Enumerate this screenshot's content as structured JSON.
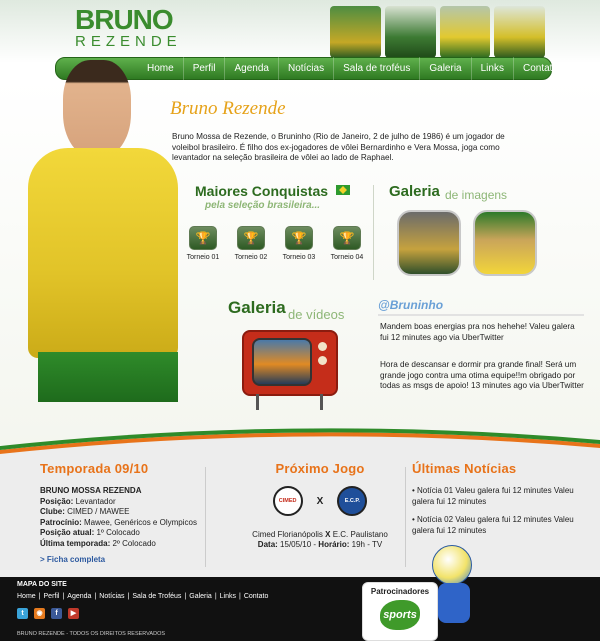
{
  "brand": {
    "line1": "BRUNO",
    "line2": "REZENDE"
  },
  "nav": [
    "Home",
    "Perfil",
    "Agenda",
    "Notícias",
    "Sala de troféus",
    "Galeria",
    "Links",
    "Contato"
  ],
  "bio": {
    "title": "Bruno Rezende",
    "text": "Bruno Mossa de Rezende, o Bruninho (Rio de Janeiro, 2 de julho de 1986) é um jogador de voleibol brasileiro. É filho dos ex-jogadores de vôlei Bernardinho e Vera Mossa, joga como levantador na seleção brasileira de vôlei ao lado de Raphael."
  },
  "conquistas": {
    "title": "Maiores Conquistas",
    "subtitle": "pela seleção brasileira...",
    "items": [
      "Torneio 01",
      "Torneio 02",
      "Torneio 03",
      "Torneio 04"
    ]
  },
  "galeria_imagens": {
    "title": "Galeria",
    "subtitle": "de imagens"
  },
  "galeria_videos": {
    "title": "Galeria",
    "subtitle": "de vídeos"
  },
  "twitter": {
    "handle": "@Bruninho",
    "tweets": [
      "Mandem boas energias pra nos hehehe! Valeu galera fui 12 minutes ago via UberTwitter",
      "Hora de descansar e dormir pra grande final! Será um grande jogo contra uma otima equipe!!m obrigado por todas as msgs de apoio! 13 minutes ago via UberTwitter"
    ]
  },
  "temporada": {
    "title": "Temporada 09/10",
    "name": "BRUNO MOSSA REZENDA",
    "rows": [
      {
        "label": "Posição:",
        "value": "Levantador"
      },
      {
        "label": "Clube:",
        "value": "CIMED / MAWEE"
      },
      {
        "label": "Patrocínio:",
        "value": "Mawee, Genéricos e Olympicos"
      },
      {
        "label": "Posição atual:",
        "value": "1º Colocado"
      },
      {
        "label": "Última temporada:",
        "value": "2º Colocado"
      }
    ],
    "link": "> Ficha completa"
  },
  "proximo_jogo": {
    "title": "Próximo Jogo",
    "team1_badge": "CIMED",
    "vs": "X",
    "team2_badge": "E.C.P.",
    "teams_a": "Cimed Florianópolis",
    "teams_x": "X",
    "teams_b": "E.C. Paulistano",
    "date_label": "Data:",
    "date": "15/05/10",
    "time_label": "Horário:",
    "time": "19h - TV"
  },
  "noticias": {
    "title": "Últimas Notícias",
    "items": [
      "• Notícia 01 Valeu galera fui 12 minutes Valeu galera fui 12 minutes",
      "• Notícia 02 Valeu galera fui 12 minutes Valeu galera fui 12 minutes"
    ]
  },
  "footer": {
    "title": "MAPA DO SITE",
    "links": [
      "Home",
      "Perfil",
      "Agenda",
      "Notícias",
      "Sala de Troféus",
      "Galeria",
      "Links",
      "Contato"
    ],
    "copyright": "BRUNO REZENDE - TODOS OS DIREITOS RESERVADOS",
    "social_icons": [
      "twitter-icon",
      "rss-icon",
      "facebook-icon",
      "youtube-icon"
    ]
  },
  "sponsor": {
    "title": "Patrocinadores",
    "logo_text": "sports"
  },
  "colors": {
    "nav_green": "#3f8f30",
    "accent_orange": "#e8731a",
    "title_gold": "#e6a21a",
    "heading_green": "#2d6b1f"
  }
}
